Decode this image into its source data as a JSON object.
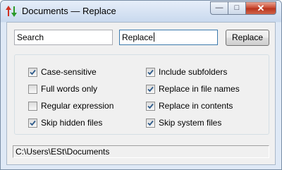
{
  "window": {
    "title": "Documents — Replace",
    "controls": {
      "minimize": "—",
      "maximize": "□",
      "close": "✕"
    }
  },
  "search": {
    "value": "Search"
  },
  "replace": {
    "value": "Replace"
  },
  "replace_button": {
    "label": "Replace"
  },
  "options": {
    "left": [
      {
        "label": "Case-sensitive",
        "checked": true
      },
      {
        "label": "Full words only",
        "checked": false
      },
      {
        "label": "Regular expression",
        "checked": false
      },
      {
        "label": "Skip hidden files",
        "checked": true
      }
    ],
    "right": [
      {
        "label": "Include subfolders",
        "checked": true
      },
      {
        "label": "Replace in file names",
        "checked": true
      },
      {
        "label": "Replace in contents",
        "checked": true
      },
      {
        "label": "Skip system files",
        "checked": true
      }
    ]
  },
  "status": {
    "path": "C:\\Users\\ESt\\Documents"
  },
  "icons": {
    "app": "up-down-arrows-icon",
    "check": "checkmark-icon"
  },
  "colors": {
    "accent": "#3d7bad",
    "close": "#c8462f",
    "arrow_up": "#d03020",
    "arrow_down": "#2a9a2a"
  }
}
